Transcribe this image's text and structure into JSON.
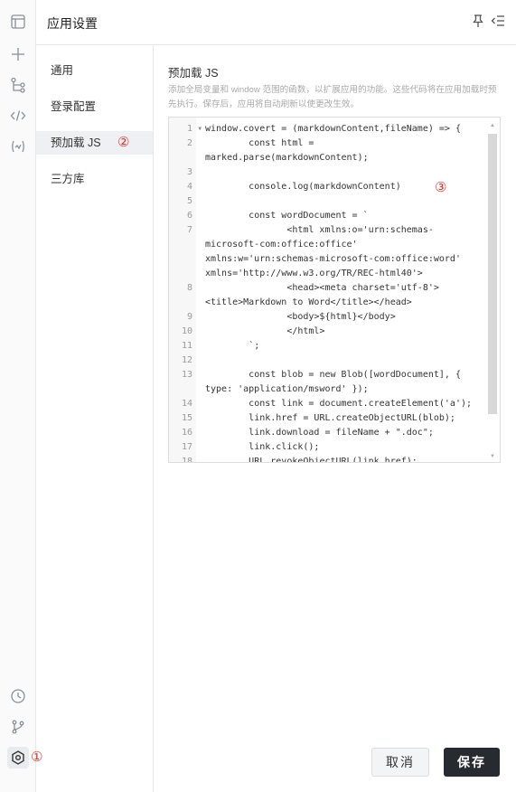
{
  "header": {
    "title": "应用设置"
  },
  "nav": {
    "items": [
      {
        "label": "通用"
      },
      {
        "label": "登录配置"
      },
      {
        "label": "预加载 JS"
      },
      {
        "label": "三方库"
      }
    ]
  },
  "annotations": {
    "one": "①",
    "two": "②",
    "three": "③"
  },
  "section": {
    "title": "预加载 JS",
    "description": "添加全局变量和 window 范围的函数，以扩展应用的功能。这些代码将在应用加载时预先执行。保存后，应用将自动刷新以使更改生效。"
  },
  "editor": {
    "lines": [
      {
        "num": "1",
        "text": "window.covert = (markdownContent,fileName) => {"
      },
      {
        "num": "2",
        "text": "        const html =\nmarked.parse(markdownContent);"
      },
      {
        "num": "3",
        "text": ""
      },
      {
        "num": "4",
        "text": "        console.log(markdownContent)"
      },
      {
        "num": "5",
        "text": ""
      },
      {
        "num": "6",
        "text": "        const wordDocument = `"
      },
      {
        "num": "7",
        "text": "               <html xmlns:o='urn:schemas-\nmicrosoft-com:office:office'\nxmlns:w='urn:schemas-microsoft-com:office:word'\nxmlns='http://www.w3.org/TR/REC-html40'>"
      },
      {
        "num": "8",
        "text": "               <head><meta charset='utf-8'>\n<title>Markdown to Word</title></head>"
      },
      {
        "num": "9",
        "text": "               <body>${html}</body>"
      },
      {
        "num": "10",
        "text": "               </html>"
      },
      {
        "num": "11",
        "text": "        `;"
      },
      {
        "num": "12",
        "text": ""
      },
      {
        "num": "13",
        "text": "        const blob = new Blob([wordDocument], {\ntype: 'application/msword' });"
      },
      {
        "num": "14",
        "text": "        const link = document.createElement('a');"
      },
      {
        "num": "15",
        "text": "        link.href = URL.createObjectURL(blob);"
      },
      {
        "num": "16",
        "text": "        link.download = fileName + \".doc\";"
      },
      {
        "num": "17",
        "text": "        link.click();"
      },
      {
        "num": "18",
        "text": "        URL.revokeObjectURL(link.href);"
      }
    ]
  },
  "buttons": {
    "cancel": "取消",
    "save": "保存"
  },
  "colors": {
    "accent": "#e5332a",
    "primary_button": "#272b30"
  }
}
